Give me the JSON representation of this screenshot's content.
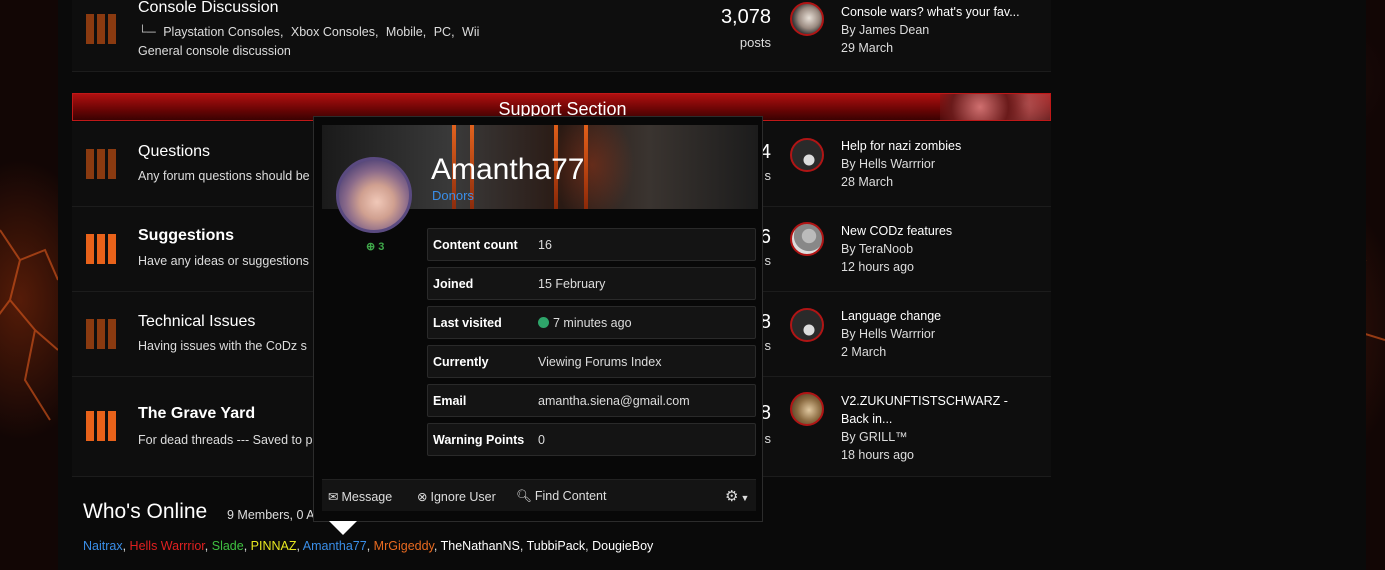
{
  "forums": [
    {
      "title": "Console Discussion",
      "subforums": [
        "Playstation Consoles",
        "Xbox Consoles",
        "Mobile",
        "PC",
        "Wii"
      ],
      "desc": "General console discussion",
      "count": "3,078",
      "count_label": "posts",
      "last_title": "Console wars? what's your fav...",
      "last_by": "By James Dean",
      "last_date": "29 March"
    },
    {
      "title": "Questions",
      "desc": "Any forum questions should be",
      "count": "4",
      "count_label": "s",
      "last_title": "Help for nazi zombies",
      "last_by": "By Hells Warrrior",
      "last_date": "28 March"
    },
    {
      "title": "Suggestions",
      "desc": "Have any ideas or suggestions",
      "count": "6",
      "count_label": "s",
      "last_title": "New CODz features",
      "last_by": "By TeraNoob",
      "last_date": "12 hours ago"
    },
    {
      "title": "Technical Issues",
      "desc": "Having issues with the CoDz s",
      "count": "8",
      "count_label": "s",
      "last_title": "Language change",
      "last_by": "By Hells Warrrior",
      "last_date": "2 March"
    },
    {
      "title": "The Grave Yard",
      "desc": "For dead threads --- Saved to p",
      "count": "8",
      "count_label": "s",
      "last_title": "V2.ZUKUNFTISTSCHWARZ -",
      "last_title2": "Back in...",
      "last_by": "By GRILL™",
      "last_date": "18 hours ago"
    }
  ],
  "support_title": "Support Section",
  "subforum_marker": "└─",
  "popup": {
    "name": "Amantha77",
    "group": "Donors",
    "reputation": "3",
    "rows": [
      {
        "key": "Content count",
        "value": "16"
      },
      {
        "key": "Joined",
        "value": "15 February"
      },
      {
        "key": "Last visited",
        "value": "7 minutes ago"
      },
      {
        "key": "Currently",
        "value": "Viewing Forums Index"
      },
      {
        "key": "Email",
        "value": "amantha.siena@gmail.com"
      },
      {
        "key": "Warning Points",
        "value": "0"
      }
    ],
    "actions": {
      "message": "Message",
      "ignore": "Ignore User",
      "find": "Find Content"
    }
  },
  "whos_online": {
    "title": "Who's Online",
    "count_text": "9 Members, 0 A",
    "members": [
      {
        "name": "Naitrax",
        "color": "#3a8ee8"
      },
      {
        "name": "Hells Warrrior",
        "color": "#e02020"
      },
      {
        "name": "Slade",
        "color": "#3fc040"
      },
      {
        "name": "PINNAZ",
        "color": "#e8e820"
      },
      {
        "name": "Amantha77",
        "color": "#3a8ee8"
      },
      {
        "name": "MrGigeddy",
        "color": "#e86a20"
      },
      {
        "name": "TheNathanNS",
        "color": "#ffffff"
      },
      {
        "name": "TubbiPack",
        "color": "#ffffff"
      },
      {
        "name": "DougieBoy",
        "color": "#ffffff"
      }
    ]
  },
  "colors": {
    "accent_red": "#b01010",
    "link_blue": "#3a8ee8",
    "online_green": "#2ea56a",
    "icon_orange": "#e8621a"
  }
}
